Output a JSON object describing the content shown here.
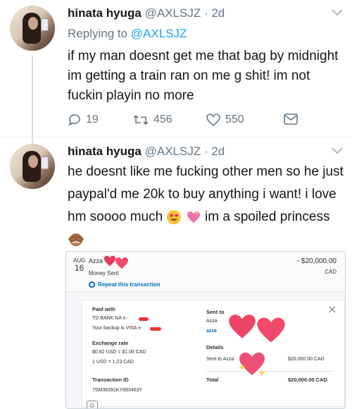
{
  "tweet1": {
    "name": "hinata hyuga",
    "handle": "@AXLSJZ",
    "time": "2d",
    "replying_prefix": "Replying to",
    "replying_to": "@AXLSJZ",
    "text": "if my man doesnt get me that bag by midnight im getting a train ran on me g shit! im not fuckin playin no more",
    "replies": "19",
    "retweets": "456",
    "likes": "550"
  },
  "tweet2": {
    "name": "hinata hyuga",
    "handle": "@AXLSJZ",
    "time": "2d",
    "text_a": "he doesnt like me fucking other men so he just paypal'd me 20k to buy anything i want! i love hm soooo much",
    "text_b": "im a spoiled princess"
  },
  "paypal": {
    "month": "AUG",
    "day": "16",
    "name": "Azza",
    "subtitle": "Money Sent",
    "amount": "- $20,000.00",
    "currency": "CAD",
    "repeat": "Repeat this transaction",
    "paid_with_label": "Paid with",
    "bank": "TD BANK NA x-",
    "backup": "Your backup is VISA x-",
    "exchange_label": "Exchange rate",
    "rate1": "$0.82 USD = $1.00 CAD",
    "rate2": "1 USD = 1.23 CAD",
    "txn_label": "Transaction ID",
    "txn_id": "7SM36391KY683463Y",
    "sent_to_label": "Sent to",
    "sent_to_name": "Azza",
    "sent_to_email": "azza",
    "details_label": "Details",
    "sent_to_line": "Sent to Azza",
    "sent_to_amount": "$20,000.00 CAD",
    "total_label": "Total",
    "total_amount": "$20,000.00 CAD"
  },
  "icons": {
    "reply": "reply-icon",
    "retweet": "retweet-icon",
    "like": "heart-icon",
    "dm": "envelope-icon",
    "caret": "chevron-down-icon"
  },
  "colors": {
    "link": "#1da1f2",
    "muted": "#657786",
    "paypal_blue": "#0070ba",
    "sticker_heart": "#e8395a"
  }
}
